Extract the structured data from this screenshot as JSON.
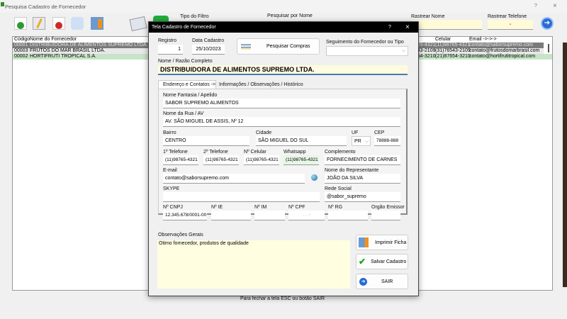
{
  "main_window": {
    "title": "Pesquisa Cadastro de Fornecedor",
    "help": "?",
    "close": "×",
    "filter_type_label": "Tipo do Filtro",
    "search_name_label": "Pesquisar por Nome",
    "track_name_label": "Rastrear Nome",
    "track_name_value": "",
    "track_phone_label": "Rastrear Telefone",
    "track_phone_value": "-",
    "table": {
      "headers": {
        "code": "Código",
        "name": "Nome do Fornecedor",
        "celular": "Celular",
        "email": "Email ->->->"
      },
      "rows": [
        {
          "code": "00001",
          "name": "DISTRIBUIDORA DE ALIMENTOS SUPREMO LTDA.",
          "phone": "8765-4321",
          "celular": "(11)98765-4321",
          "email": "contato@saborsupremo.com"
        },
        {
          "code": "00003",
          "name": "FRUTOS DO MAR BRASIL LTDA.",
          "phone": "6543-2109",
          "celular": "(31)76543-2109",
          "email": "contato@frutosdomarbrasil.com"
        },
        {
          "code": "00002",
          "name": "HORTIFRUTI TROPICAL S.A.",
          "phone": "7654-3210",
          "celular": "(21)87654-3210",
          "email": "contato@hortifrutitropical.com"
        }
      ]
    },
    "status": "Para fechar a tela ESC ou botão SAIR"
  },
  "dialog": {
    "title": "Tela Cadastro de Fornecedor",
    "help": "?",
    "close": "×",
    "registro_label": "Registro",
    "registro": "1",
    "data_label": "Data Cadastro",
    "data": "25/10/2023",
    "pesquisar_compras": "Pesquisar Compras",
    "segmento_label": "Seguimento do Fornecedor ou Tipo",
    "segmento": "",
    "razao_label": "Nome / Razão Completo",
    "razao": "DISTRIBUIDORA DE ALIMENTOS SUPREMO LTDA.",
    "tabs": [
      "Endereço e Contatos ->",
      "Informações / Observações / Histórico"
    ],
    "fantasia_label": "Nome Fantasia / Apelido",
    "fantasia": "SABOR SUPREMO ALIMENTOS",
    "rua_label": "Nome da Rua / AV",
    "rua": "AV. SÃO MIGUEL DE ASSIS, Nº 12",
    "bairro_label": "Bairro",
    "bairro": "CENTRO",
    "cidade_label": "Cidade",
    "cidade": "SÃO MIGUEL DO SUL",
    "uf_label": "UF",
    "uf": "PR",
    "cep_label": "CEP",
    "cep": "78888-888",
    "tel1_label": "1º Telefone",
    "tel1": "(11)98765-4321",
    "tel2_label": "2º Telefone",
    "tel2": "(11)98765-4321",
    "cel_label": "Nº Celular",
    "cel": "(11)98765-4321",
    "whats_label": "Whatsapp",
    "whats": "(11)98765-4321",
    "compl_label": "Complemento",
    "compl": "FORNECIMENTO DE CARNES",
    "email_label": "E-mail",
    "email": "contato@saborsupremo.com",
    "rep_label": "Nome do Representante",
    "rep": "JOÃO DA SILVA",
    "skype_label": "SKYPE",
    "skype": "",
    "rede_label": "Rede Social",
    "rede": "@sabor_supremo",
    "cnpj_label": "Nº CNPJ",
    "cnpj": "12.345.678/0001-00",
    "ie_label": "Nº IE",
    "im_label": "Nº IM",
    "cpf_label": "Nº CPF",
    "cpf": ". . -",
    "rg_label": "Nº RG",
    "orgao_label": "Orgão Emissor",
    "obs_label": "Observações Gerais",
    "obs": "Otimo fornecedor, produtos de qualidade",
    "imprimir": "Imprimir Ficha",
    "salvar": "Salvar Cadastro",
    "sair": "SAIR"
  }
}
